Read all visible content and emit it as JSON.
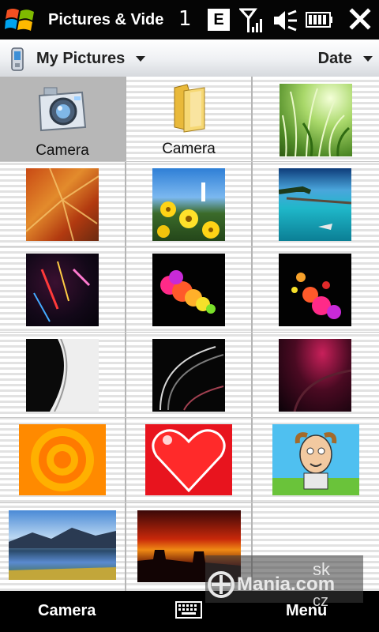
{
  "status_bar": {
    "app_title": "Pictures & Videos",
    "notification_count": "1",
    "network_type": "E",
    "icons": [
      "windows-start-icon",
      "signal-icon",
      "volume-muted-icon",
      "battery-icon",
      "close-icon"
    ]
  },
  "header": {
    "folder": "My Pictures",
    "sort": "Date"
  },
  "grid": {
    "items": [
      {
        "kind": "camera",
        "label": "Camera",
        "selected": true
      },
      {
        "kind": "folder",
        "label": "Camera"
      },
      {
        "kind": "photo",
        "subject": "grass"
      },
      {
        "kind": "photo",
        "subject": "autumn-leaf"
      },
      {
        "kind": "photo",
        "subject": "yellow-flowers"
      },
      {
        "kind": "photo",
        "subject": "tropical-pier"
      },
      {
        "kind": "photo",
        "subject": "light-streaks"
      },
      {
        "kind": "photo",
        "subject": "color-bubbles"
      },
      {
        "kind": "photo",
        "subject": "color-bubbles-2"
      },
      {
        "kind": "photo",
        "subject": "silver-curve"
      },
      {
        "kind": "photo",
        "subject": "dark-swirl"
      },
      {
        "kind": "photo",
        "subject": "pink-glow"
      },
      {
        "kind": "photo",
        "subject": "orange-target"
      },
      {
        "kind": "photo",
        "subject": "red-heart"
      },
      {
        "kind": "photo",
        "subject": "cartoon-man"
      },
      {
        "kind": "photo",
        "subject": "mountain-lake"
      },
      {
        "kind": "photo",
        "subject": "desert-sunset"
      }
    ]
  },
  "watermark": {
    "main": "Mania.com",
    "sk": "sk",
    "cz": "cz"
  },
  "softkeys": {
    "left": "Camera",
    "right": "Menu"
  },
  "colors": {
    "titlebar": "#050505",
    "selected_cell": "#b7b7b7",
    "softbar": "#000000"
  }
}
